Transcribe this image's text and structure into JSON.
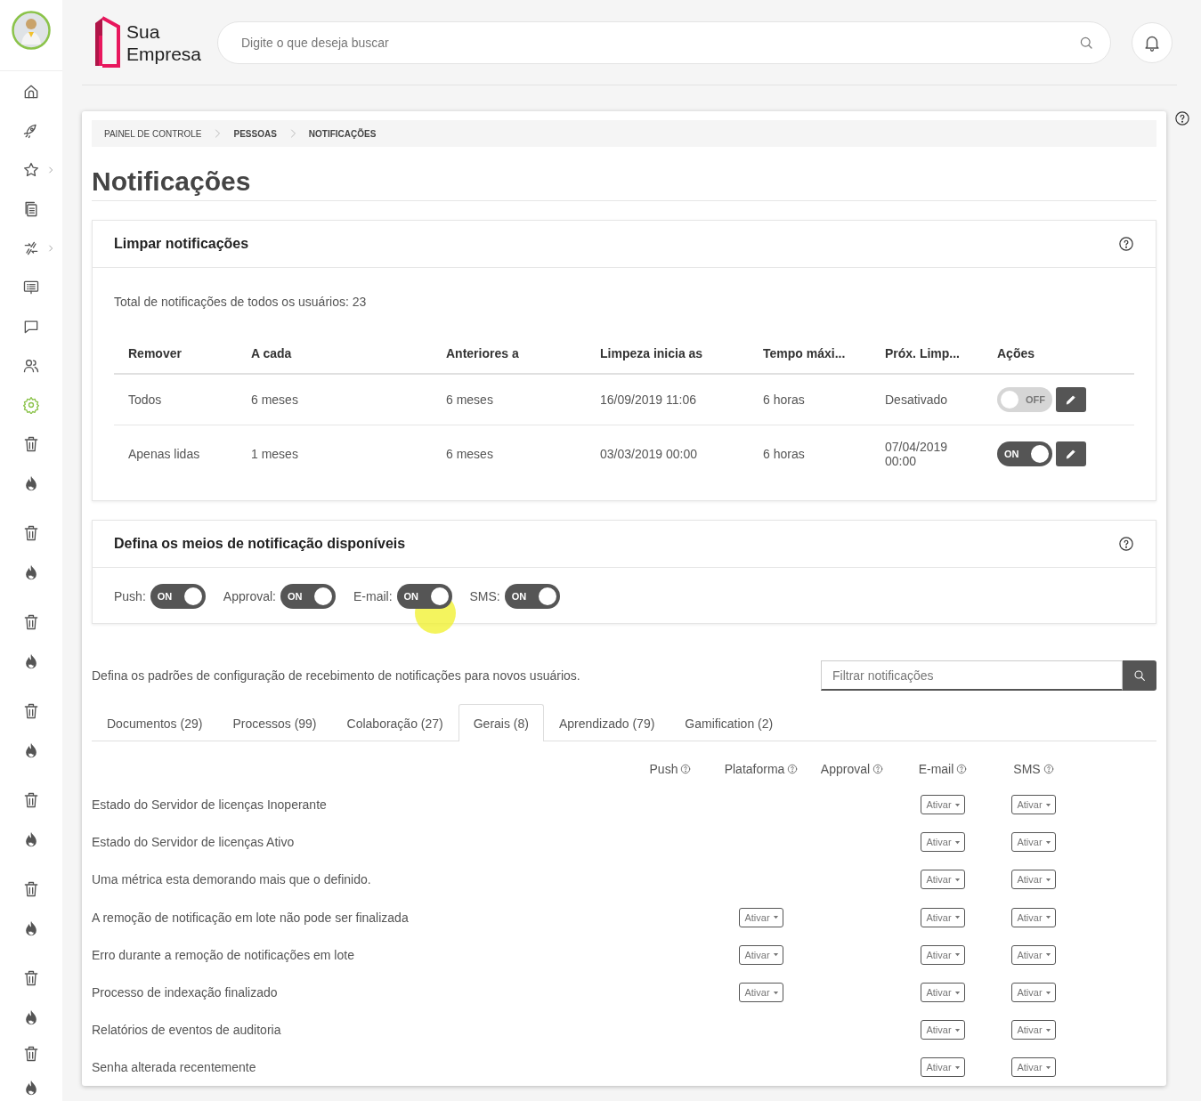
{
  "sidebar": {
    "items": [
      {
        "kind": "home",
        "selected": false,
        "submenu": false
      },
      {
        "kind": "rocket",
        "selected": false,
        "submenu": false
      },
      {
        "kind": "star",
        "selected": false,
        "submenu": true
      },
      {
        "kind": "documents",
        "selected": false,
        "submenu": false
      },
      {
        "kind": "arrows",
        "selected": false,
        "submenu": true
      },
      {
        "kind": "board",
        "selected": false,
        "submenu": false
      },
      {
        "kind": "chat",
        "selected": false,
        "submenu": false
      },
      {
        "kind": "users",
        "selected": false,
        "submenu": false
      },
      {
        "kind": "settings",
        "selected": true,
        "submenu": false
      },
      {
        "kind": "trash",
        "selected": false,
        "submenu": false
      },
      {
        "kind": "flame",
        "selected": false,
        "submenu": false
      },
      {
        "kind": "trash",
        "selected": false,
        "submenu": false
      },
      {
        "kind": "flame",
        "selected": false,
        "submenu": false
      },
      {
        "kind": "trash",
        "selected": false,
        "submenu": false
      },
      {
        "kind": "flame",
        "selected": false,
        "submenu": false
      },
      {
        "kind": "trash",
        "selected": false,
        "submenu": false
      },
      {
        "kind": "flame",
        "selected": false,
        "submenu": false
      },
      {
        "kind": "trash",
        "selected": false,
        "submenu": false
      },
      {
        "kind": "flame",
        "selected": false,
        "submenu": false
      },
      {
        "kind": "trash",
        "selected": false,
        "submenu": false
      },
      {
        "kind": "flame",
        "selected": false,
        "submenu": false
      },
      {
        "kind": "trash",
        "selected": false,
        "submenu": false
      },
      {
        "kind": "flame",
        "selected": false,
        "submenu": false
      },
      {
        "kind": "trash",
        "selected": false,
        "submenu": false
      },
      {
        "kind": "flame",
        "selected": false,
        "submenu": false
      }
    ]
  },
  "header": {
    "logo": {
      "line_1": "Sua",
      "line_2": "Empresa"
    },
    "search": {
      "placeholder": "Digite o que deseja buscar"
    }
  },
  "breadcrumb": [
    {
      "label": "PAINEL DE CONTROLE"
    },
    {
      "label": "PESSOAS"
    },
    {
      "label": "NOTIFICAÇÕES"
    }
  ],
  "title": "Notificações",
  "clean_card": {
    "title": "Limpar notificações",
    "total": "Total de notificações de todos os usuários: 23",
    "columns": [
      "Remover",
      "A cada",
      "Anteriores a",
      "Limpeza inicia as",
      "Tempo máxi...",
      "Próx. Limp...",
      "Ações"
    ],
    "rows": [
      {
        "cells": [
          "Todos",
          "6 meses",
          "6 meses",
          "16/09/2019 11:06",
          "6 horas",
          "Desativado"
        ],
        "on": false,
        "toggle_text": "OFF"
      },
      {
        "cells": [
          "Apenas lidas",
          "1 meses",
          "6 meses",
          "03/03/2019 00:00",
          "6 horas",
          "07/04/2019 00:00"
        ],
        "on": true,
        "toggle_text": "ON"
      }
    ]
  },
  "means_card": {
    "title": "Defina os meios de notificação disponíveis",
    "toggles": [
      {
        "label": "Push:",
        "on": true,
        "text": "ON"
      },
      {
        "label": "Approval:",
        "on": true,
        "text": "ON"
      },
      {
        "label": "E-mail:",
        "on": true,
        "text": "ON"
      },
      {
        "label": "SMS:",
        "on": true,
        "text": "ON"
      }
    ]
  },
  "defaults": {
    "description": "Defina os padrões de configuração de recebimento de notificações para novos usuários.",
    "filter": {
      "placeholder": "Filtrar notificações"
    },
    "tabs": [
      {
        "label": "Documentos (29)",
        "selected": false
      },
      {
        "label": "Processos (99)",
        "selected": false
      },
      {
        "label": "Colaboração (27)",
        "selected": false
      },
      {
        "label": "Gerais (8)",
        "selected": true
      },
      {
        "label": "Aprendizado (79)",
        "selected": false
      },
      {
        "label": "Gamification (2)",
        "selected": false
      }
    ],
    "columns": [
      "Push",
      "Plataforma",
      "Approval",
      "E-mail",
      "SMS"
    ],
    "rows": [
      {
        "label": "Estado do Servidor de licenças Inoperante",
        "cells": [
          null,
          null,
          null,
          "Ativar",
          "Ativar"
        ]
      },
      {
        "label": "Estado do Servidor de licenças Ativo",
        "cells": [
          null,
          null,
          null,
          "Ativar",
          "Ativar"
        ]
      },
      {
        "label": "Uma métrica esta demorando mais que o definido.",
        "cells": [
          null,
          null,
          null,
          "Ativar",
          "Ativar"
        ]
      },
      {
        "label": "A remoção de notificação em lote não pode ser finalizada",
        "cells": [
          null,
          "Ativar",
          null,
          "Ativar",
          "Ativar"
        ]
      },
      {
        "label": "Erro durante a remoção de notificações em lote",
        "cells": [
          null,
          "Ativar",
          null,
          "Ativar",
          "Ativar"
        ]
      },
      {
        "label": "Processo de indexação finalizado",
        "cells": [
          null,
          "Ativar",
          null,
          "Ativar",
          "Ativar"
        ]
      },
      {
        "label": "Relatórios de eventos de auditoria",
        "cells": [
          null,
          null,
          null,
          "Ativar",
          "Ativar"
        ]
      },
      {
        "label": "Senha alterada recentemente",
        "cells": [
          null,
          null,
          null,
          "Ativar",
          "Ativar"
        ]
      }
    ]
  }
}
